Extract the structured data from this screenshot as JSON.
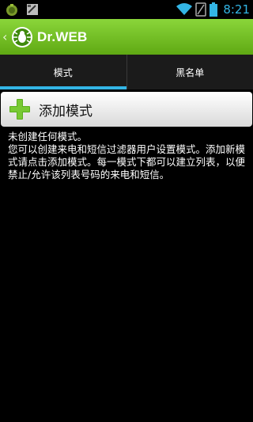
{
  "status_bar": {
    "time": "8:21",
    "icons": [
      "android-debug-icon",
      "sd-card-icon",
      "wifi-icon",
      "no-sim-icon",
      "battery-icon"
    ]
  },
  "action_bar": {
    "title": "Dr.WEB",
    "accent": "#6cbf24"
  },
  "tabs": [
    {
      "label": "模式",
      "active": true
    },
    {
      "label": "黑名单",
      "active": false
    }
  ],
  "add_button": {
    "label": "添加模式"
  },
  "message": {
    "line1": "未创建任何模式。",
    "line2": "您可以创建来电和短信过滤器用户设置模式。添加新模式请点击添加模式。每一模式下都可以建立列表，以便禁止/允许该列表号码的来电和短信。"
  },
  "colors": {
    "tab_indicator": "#33b5e5",
    "time": "#33b5e5"
  }
}
